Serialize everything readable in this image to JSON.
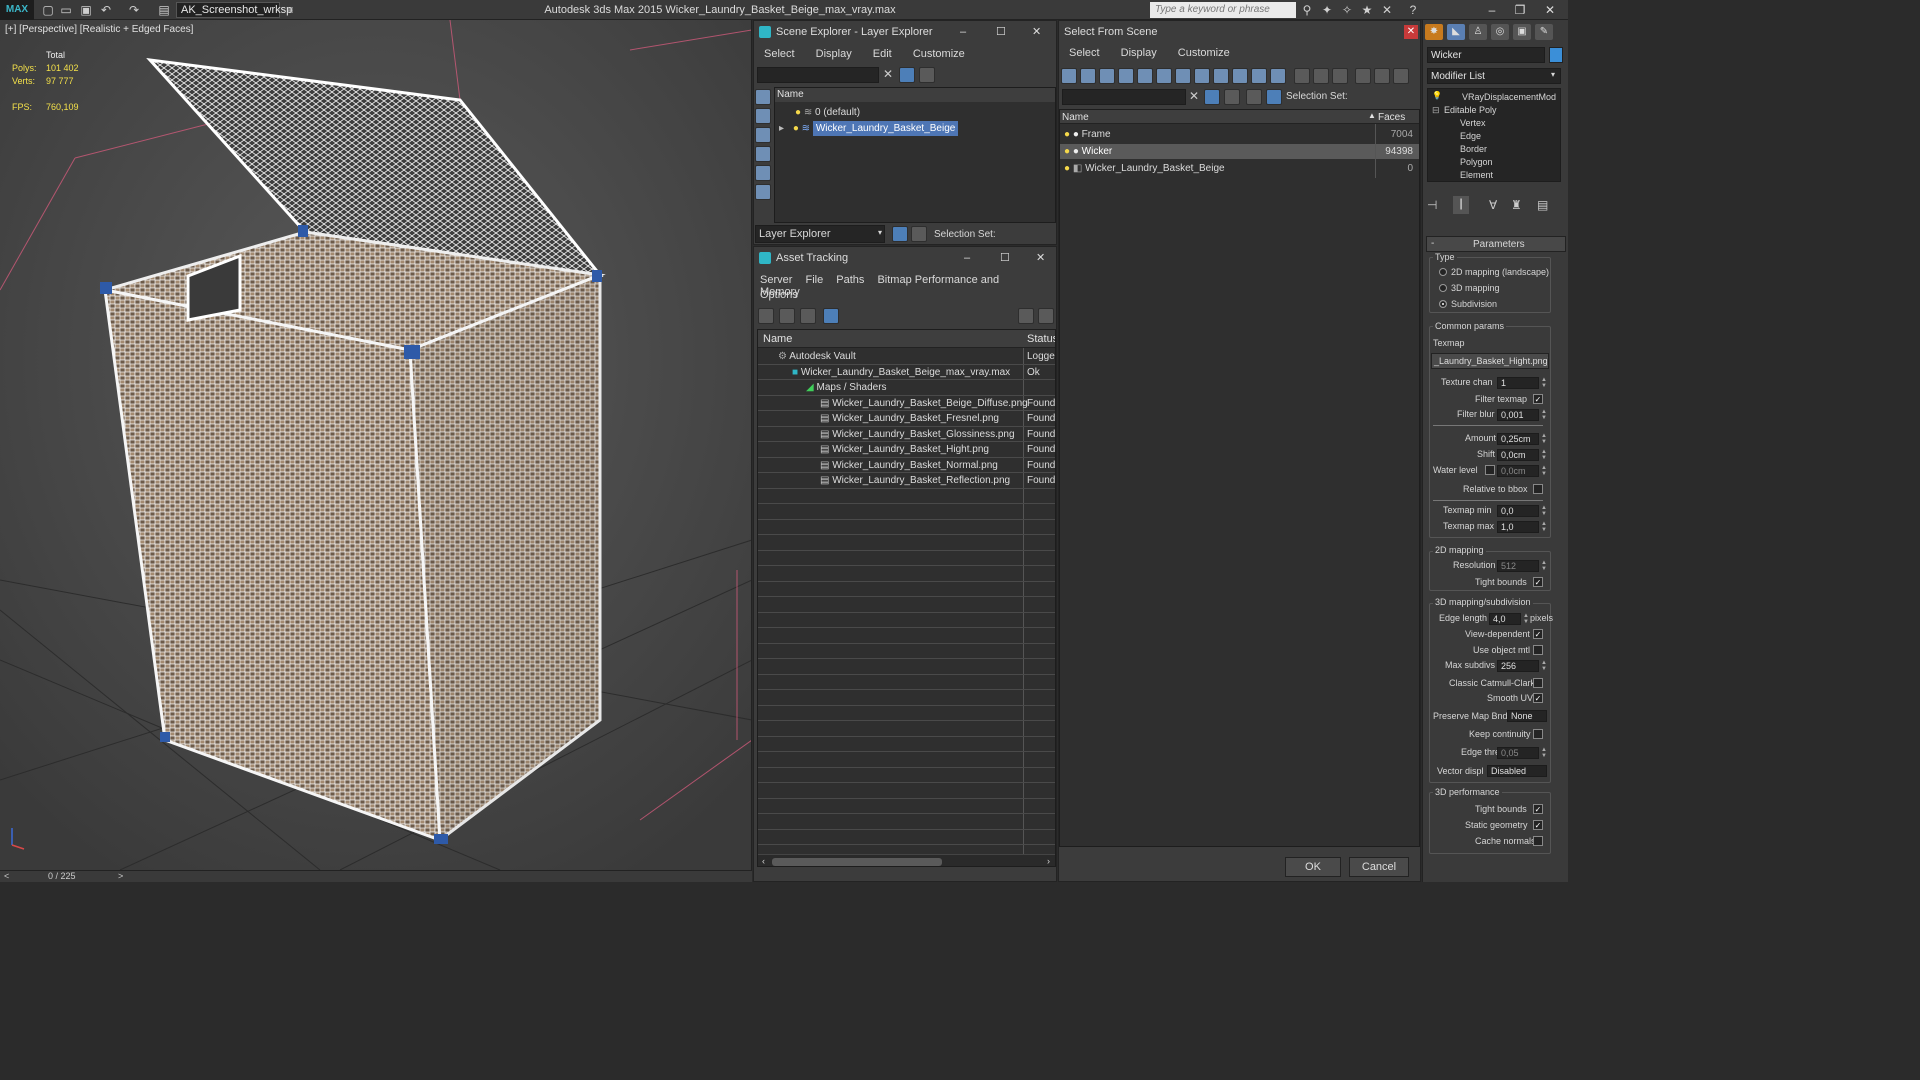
{
  "app": {
    "logo": "MAX",
    "workspace": "AK_Screenshot_wrksp",
    "title": "Autodesk 3ds Max  2015    Wicker_Laundry_Basket_Beige_max_vray.max",
    "search_placeholder": "Type a keyword or phrase"
  },
  "viewport": {
    "label": "[+] [Perspective] [Realistic + Edged Faces]",
    "stats": {
      "total_label": "Total",
      "polys_label": "Polys:",
      "polys": "101 402",
      "verts_label": "Verts:",
      "verts": "97 777",
      "fps_label": "FPS:",
      "fps": "760,109"
    },
    "timeline": "0 / 225",
    "prev": "<",
    "next": ">"
  },
  "scene_explorer": {
    "title": "Scene Explorer - Layer Explorer",
    "menu": [
      "Select",
      "Display",
      "Edit",
      "Customize"
    ],
    "col_name": "Name",
    "rows": [
      {
        "label": "0 (default)"
      },
      {
        "label": "Wicker_Laundry_Basket_Beige"
      }
    ],
    "footer_label": "Layer Explorer",
    "selection_set": "Selection Set:"
  },
  "asset_tracking": {
    "title": "Asset Tracking",
    "menu": [
      "Server",
      "File",
      "Paths",
      "Bitmap Performance and Memory"
    ],
    "menu2": "Options",
    "col_name": "Name",
    "col_status": "Status",
    "rows": [
      {
        "name": "Autodesk Vault",
        "status": "Logged"
      },
      {
        "name": "Wicker_Laundry_Basket_Beige_max_vray.max",
        "status": "Ok"
      },
      {
        "name": "Maps / Shaders",
        "status": ""
      },
      {
        "name": "Wicker_Laundry_Basket_Beige_Diffuse.png",
        "status": "Found"
      },
      {
        "name": "Wicker_Laundry_Basket_Fresnel.png",
        "status": "Found"
      },
      {
        "name": "Wicker_Laundry_Basket_Glossiness.png",
        "status": "Found"
      },
      {
        "name": "Wicker_Laundry_Basket_Hight.png",
        "status": "Found"
      },
      {
        "name": "Wicker_Laundry_Basket_Normal.png",
        "status": "Found"
      },
      {
        "name": "Wicker_Laundry_Basket_Reflection.png",
        "status": "Found"
      }
    ]
  },
  "select_from_scene": {
    "title": "Select From Scene",
    "menu": [
      "Select",
      "Display",
      "Customize"
    ],
    "selection_set": "Selection Set:",
    "col_name": "Name",
    "col_faces": "Faces",
    "rows": [
      {
        "name": "Frame",
        "faces": "7004"
      },
      {
        "name": "Wicker",
        "faces": "94398"
      },
      {
        "name": "Wicker_Laundry_Basket_Beige",
        "faces": "0"
      }
    ],
    "ok": "OK",
    "cancel": "Cancel"
  },
  "modify_panel": {
    "object_name": "Wicker",
    "modifier_list": "Modifier List",
    "stack": [
      "VRayDisplacementMod",
      "Editable Poly",
      "Vertex",
      "Edge",
      "Border",
      "Polygon",
      "Element"
    ],
    "parameters": "Parameters",
    "type_label": "Type",
    "types": [
      "2D mapping (landscape)",
      "3D mapping",
      "Subdivision"
    ],
    "common_params": "Common params",
    "texmap_label": "Texmap",
    "texmap": "_Laundry_Basket_Hight.png)",
    "texture_chan_label": "Texture chan",
    "texture_chan": "1",
    "filter_texmap": "Filter texmap",
    "filter_blur_label": "Filter blur",
    "filter_blur": "0,001",
    "amount_label": "Amount",
    "amount": "0,25cm",
    "shift_label": "Shift",
    "shift": "0,0cm",
    "water_level_label": "Water level",
    "water_level": "0,0cm",
    "relative_bbox": "Relative to bbox",
    "texmap_min_label": "Texmap min",
    "texmap_min": "0,0",
    "texmap_max_label": "Texmap max",
    "texmap_max": "1,0",
    "mapping2d": "2D mapping",
    "resolution_label": "Resolution",
    "resolution": "512",
    "tight_bounds": "Tight bounds",
    "mapping3d": "3D mapping/subdivision",
    "edge_length_label": "Edge length",
    "edge_length": "4,0",
    "pixels": "pixels",
    "view_dependent": "View-dependent",
    "use_object_mtl": "Use object mtl",
    "max_subdivs_label": "Max subdivs",
    "max_subdivs": "256",
    "classic_catmull": "Classic Catmull-Clark",
    "smooth_uvs": "Smooth UVs",
    "preserve_map_label": "Preserve Map Bnd",
    "preserve_map": "None",
    "keep_continuity": "Keep continuity",
    "edge_thresh_label": "Edge thresh",
    "edge_thresh": "0,05",
    "vector_displ_label": "Vector displ",
    "vector_displ": "Disabled",
    "perf3d": "3D performance",
    "tight_bounds2": "Tight bounds",
    "static_geometry": "Static geometry",
    "cache_normals": "Cache normals"
  },
  "colors": {
    "accent": "#4e76b5",
    "stat_yellow": "#f3e04a"
  }
}
